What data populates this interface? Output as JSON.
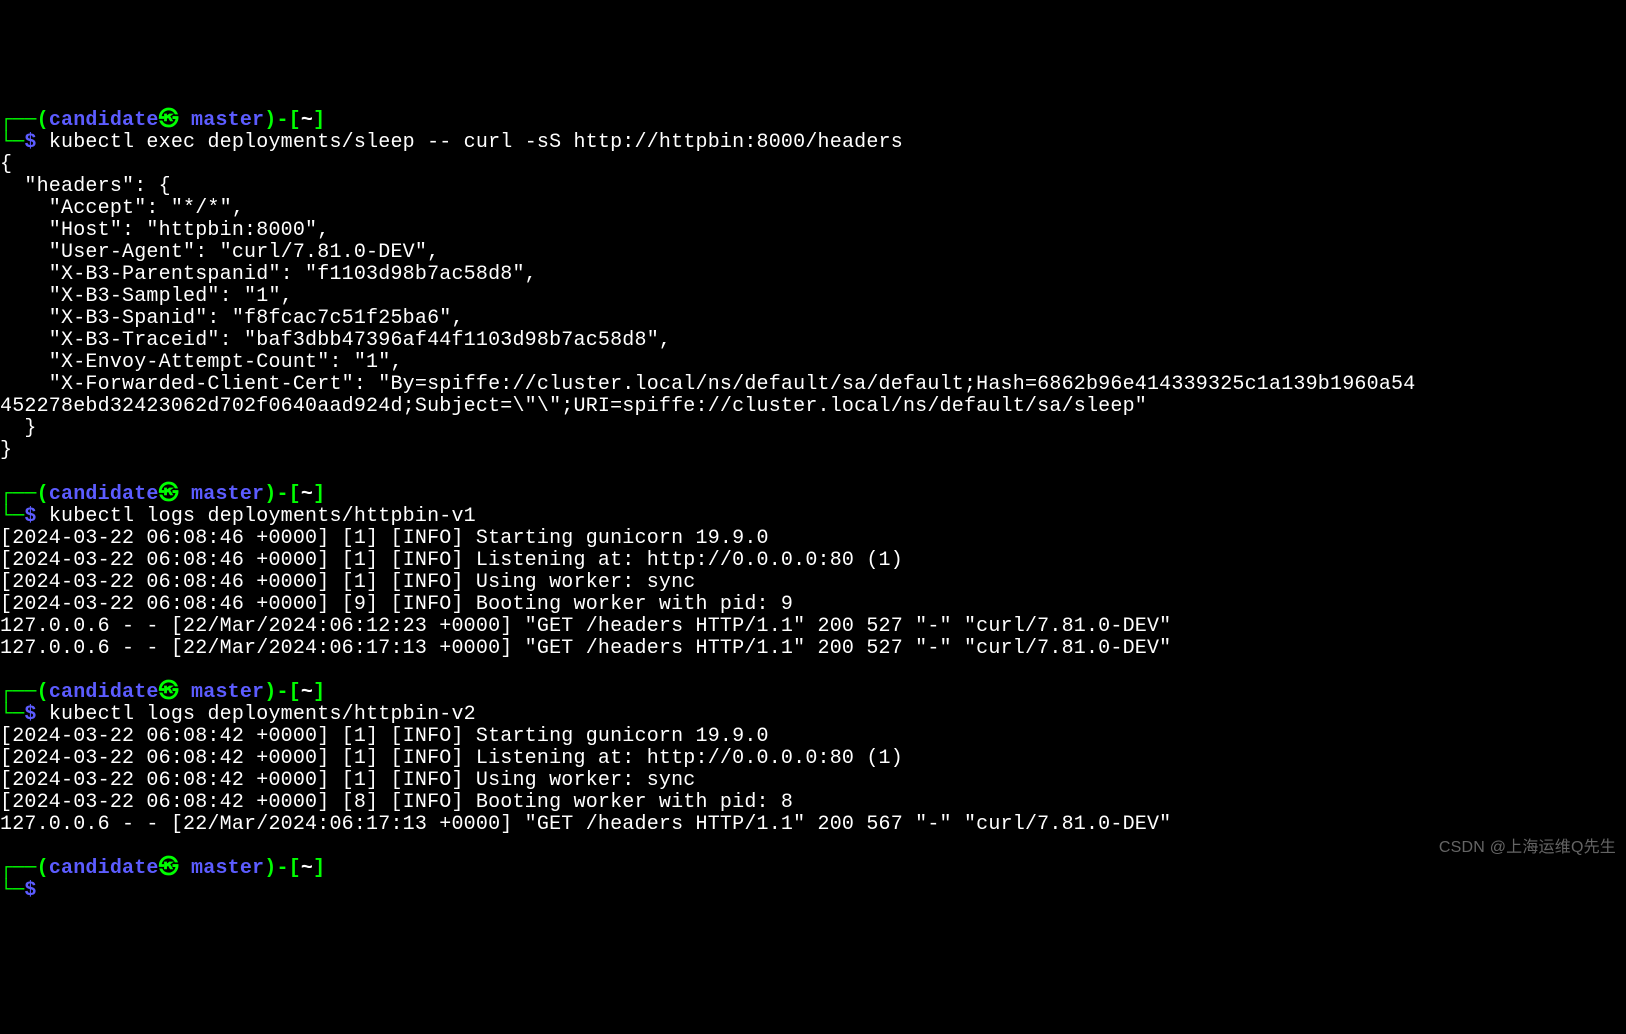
{
  "prompt": {
    "corner_tl": "┌──",
    "corner_bl": "└─",
    "open_paren": "(",
    "close_paren": ")",
    "user": "candidate",
    "host_sep": "㉿ ",
    "host": "master",
    "dash_open": "-[",
    "tilde": "~",
    "dash_close": "]",
    "dollar": "$ "
  },
  "blocks": [
    {
      "command": "kubectl exec deployments/sleep -- curl -sS http://httpbin:8000/headers",
      "output_lines": [
        "{",
        "  \"headers\": {",
        "    \"Accept\": \"*/*\",",
        "    \"Host\": \"httpbin:8000\",",
        "    \"User-Agent\": \"curl/7.81.0-DEV\",",
        "    \"X-B3-Parentspanid\": \"f1103d98b7ac58d8\",",
        "    \"X-B3-Sampled\": \"1\",",
        "    \"X-B3-Spanid\": \"f8fcac7c51f25ba6\",",
        "    \"X-B3-Traceid\": \"baf3dbb47396af44f1103d98b7ac58d8\",",
        "    \"X-Envoy-Attempt-Count\": \"1\",",
        "    \"X-Forwarded-Client-Cert\": \"By=spiffe://cluster.local/ns/default/sa/default;Hash=6862b96e414339325c1a139b1960a54",
        "452278ebd32423062d702f0640aad924d;Subject=\\\"\\\";URI=spiffe://cluster.local/ns/default/sa/sleep\"",
        "  }",
        "}",
        ""
      ]
    },
    {
      "command": "kubectl logs deployments/httpbin-v1",
      "output_lines": [
        "[2024-03-22 06:08:46 +0000] [1] [INFO] Starting gunicorn 19.9.0",
        "[2024-03-22 06:08:46 +0000] [1] [INFO] Listening at: http://0.0.0.0:80 (1)",
        "[2024-03-22 06:08:46 +0000] [1] [INFO] Using worker: sync",
        "[2024-03-22 06:08:46 +0000] [9] [INFO] Booting worker with pid: 9",
        "127.0.0.6 - - [22/Mar/2024:06:12:23 +0000] \"GET /headers HTTP/1.1\" 200 527 \"-\" \"curl/7.81.0-DEV\"",
        "127.0.0.6 - - [22/Mar/2024:06:17:13 +0000] \"GET /headers HTTP/1.1\" 200 527 \"-\" \"curl/7.81.0-DEV\"",
        ""
      ]
    },
    {
      "command": "kubectl logs deployments/httpbin-v2",
      "output_lines": [
        "[2024-03-22 06:08:42 +0000] [1] [INFO] Starting gunicorn 19.9.0",
        "[2024-03-22 06:08:42 +0000] [1] [INFO] Listening at: http://0.0.0.0:80 (1)",
        "[2024-03-22 06:08:42 +0000] [1] [INFO] Using worker: sync",
        "[2024-03-22 06:08:42 +0000] [8] [INFO] Booting worker with pid: 8",
        "127.0.0.6 - - [22/Mar/2024:06:17:13 +0000] \"GET /headers HTTP/1.1\" 200 567 \"-\" \"curl/7.81.0-DEV\"",
        ""
      ]
    },
    {
      "command": "",
      "output_lines": []
    }
  ],
  "watermark": "CSDN @上海运维Q先生"
}
